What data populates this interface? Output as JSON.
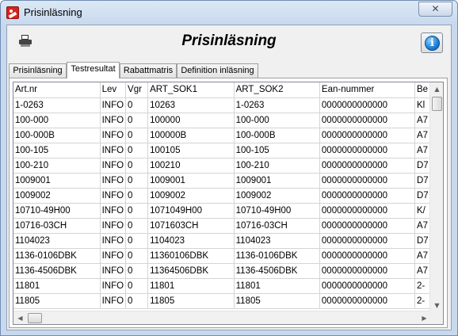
{
  "window": {
    "title": "Prisinläsning",
    "close_symbol": "✕",
    "icon": "app-icon"
  },
  "header": {
    "title": "Prisinläsning",
    "print_icon": "printer-icon",
    "info_icon": "info-icon",
    "info_symbol": "i"
  },
  "tabs": [
    {
      "label": "Prisinläsning",
      "active": false
    },
    {
      "label": "Testresultat",
      "active": true
    },
    {
      "label": "Rabattmatris",
      "active": false
    },
    {
      "label": "Definition inläsning",
      "active": false
    }
  ],
  "grid": {
    "columns": [
      "Art.nr",
      "Lev",
      "Vgr",
      "ART_SOK1",
      "ART_SOK2",
      "Ean-nummer",
      "Be"
    ],
    "rows": [
      [
        "1-0263",
        "INFO",
        "0",
        "10263",
        "1-0263",
        "0000000000000",
        "Kl"
      ],
      [
        "100-000",
        "INFO",
        "0",
        "100000",
        "100-000",
        "0000000000000",
        "A7"
      ],
      [
        "100-000B",
        "INFO",
        "0",
        "100000B",
        "100-000B",
        "0000000000000",
        "A7"
      ],
      [
        "100-105",
        "INFO",
        "0",
        "100105",
        "100-105",
        "0000000000000",
        "A7"
      ],
      [
        "100-210",
        "INFO",
        "0",
        "100210",
        "100-210",
        "0000000000000",
        "D7"
      ],
      [
        "1009001",
        "INFO",
        "0",
        "1009001",
        "1009001",
        "0000000000000",
        "D7"
      ],
      [
        "1009002",
        "INFO",
        "0",
        "1009002",
        "1009002",
        "0000000000000",
        "D7"
      ],
      [
        "10710-49H00",
        "INFO",
        "0",
        "1071049H00",
        "10710-49H00",
        "0000000000000",
        "K/"
      ],
      [
        "10716-03CH",
        "INFO",
        "0",
        "1071603CH",
        "10716-03CH",
        "0000000000000",
        "A7"
      ],
      [
        "1104023",
        "INFO",
        "0",
        "1104023",
        "1104023",
        "0000000000000",
        "D7"
      ],
      [
        "1136-0106DBK",
        "INFO",
        "0",
        "11360106DBK",
        "1136-0106DBK",
        "0000000000000",
        "A7"
      ],
      [
        "1136-4506DBK",
        "INFO",
        "0",
        "11364506DBK",
        "1136-4506DBK",
        "0000000000000",
        "A7"
      ],
      [
        "11801",
        "INFO",
        "0",
        "11801",
        "11801",
        "0000000000000",
        "2-"
      ],
      [
        "11805",
        "INFO",
        "0",
        "11805",
        "11805",
        "0000000000000",
        "2-"
      ]
    ]
  },
  "scrollbars": {
    "up_symbol": "▲",
    "down_symbol": "▼",
    "left_symbol": "◀",
    "right_symbol": "▶"
  }
}
